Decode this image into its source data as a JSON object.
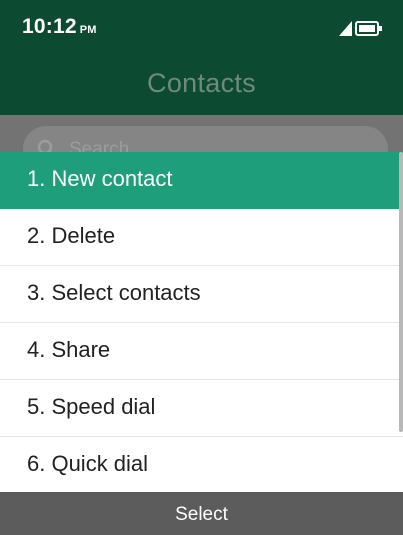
{
  "status_bar": {
    "time": "10:12",
    "ampm": "PM",
    "icons": [
      "signal-icon",
      "battery-icon"
    ]
  },
  "header": {
    "title": "Contacts"
  },
  "search": {
    "placeholder": "Search"
  },
  "menu": {
    "selected_index": 0,
    "items": [
      {
        "label": "1. New contact"
      },
      {
        "label": "2. Delete"
      },
      {
        "label": "3. Select contacts"
      },
      {
        "label": "4. Share"
      },
      {
        "label": "5. Speed dial"
      },
      {
        "label": "6. Quick dial"
      }
    ]
  },
  "softkeys": {
    "center": "Select"
  },
  "colors": {
    "header_bg": "#0d4a32",
    "selected_bg": "#1f9e7c",
    "softkey_bg": "#5c5c5c"
  }
}
